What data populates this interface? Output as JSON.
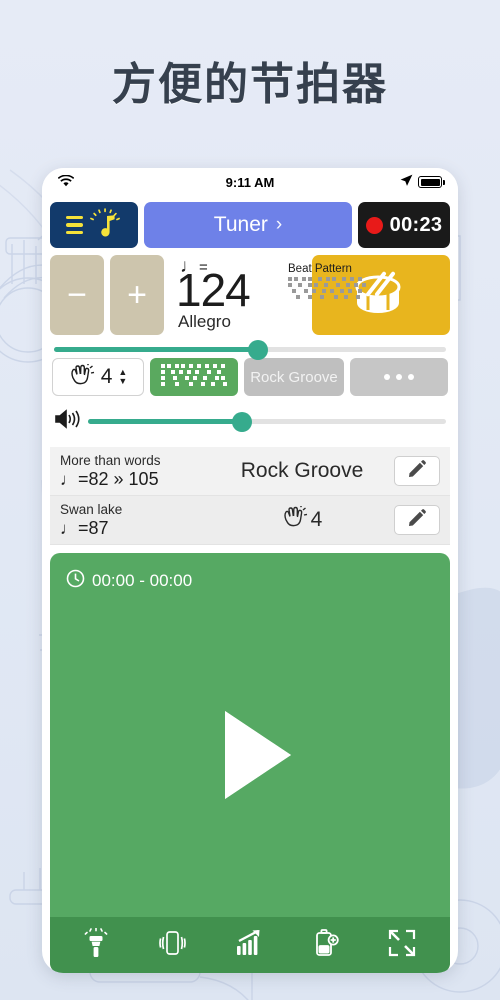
{
  "headline": "方便的节拍器",
  "statusbar": {
    "wifi_icon": "wifi-icon",
    "time": "9:11 AM",
    "location_icon": "location-arrow-icon",
    "battery_icon": "battery-full-icon"
  },
  "toolbar_top": {
    "menu_icon": "hamburger-icon",
    "metronome_icon": "metronome-note-icon",
    "tuner_label": "Tuner",
    "tuner_chevron": "›",
    "record_dot_icon": "record-dot-icon",
    "record_time": "00:23"
  },
  "tempo": {
    "minus_label": "−",
    "plus_label": "+",
    "note_glyph": "♩",
    "equals": "=",
    "bpm": "124",
    "tempo_name": "Allegro",
    "beat_pattern_label": "Beat Pattern",
    "drum_icon": "snare-drum-icon",
    "tempo_slider_percent": 52
  },
  "volume": {
    "speaker_icon": "speaker-waves-icon",
    "volume_slider_percent": 43
  },
  "beatrow": {
    "hands_icon": "clapping-hands-icon",
    "beats": "4",
    "stepper_up": "▲",
    "stepper_down": "▼",
    "pattern_icon": "beat-pattern-icon",
    "groove_label": "Rock Groove",
    "more_icon": "ellipsis-icon"
  },
  "songs": [
    {
      "title": "More than words",
      "note_glyph": "♩",
      "bpm": "=82 » 105",
      "middle": "Rock Groove",
      "middle_icon": "",
      "edit_icon": "pencil-icon"
    },
    {
      "title": "Swan lake",
      "note_glyph": "♩",
      "bpm": "=87",
      "middle": "4",
      "middle_icon": "clapping-hands-icon",
      "edit_icon": "pencil-icon"
    }
  ],
  "player": {
    "clock_icon": "clock-icon",
    "time_range": "00:00 - 00:00",
    "play_icon": "play-triangle-icon",
    "tools": [
      {
        "icon": "flashlight-icon",
        "label": "Flashlight"
      },
      {
        "icon": "vibrate-phone-icon",
        "label": "Vibrate"
      },
      {
        "icon": "bar-chart-up-icon",
        "label": "Tempo Ramp"
      },
      {
        "icon": "battery-plus-icon",
        "label": "Battery Saver"
      },
      {
        "icon": "fullscreen-expand-icon",
        "label": "Fullscreen"
      }
    ]
  },
  "colors": {
    "page_background": "#e3e9f4",
    "headline": "#36404e",
    "menu_navy": "#123a6b",
    "menu_yellow": "#f5e23a",
    "tuner_blue": "#6e81e8",
    "record_black": "#1a1a1a",
    "record_red": "#e81a19",
    "step_tan": "#cdc5ad",
    "drum_gold": "#e8b51e",
    "slider_teal": "#36ab8d",
    "pattern_green": "#5aa95f",
    "grey_button": "#bfbfbf",
    "player_green": "#56a963",
    "toolbar_green": "#41914e"
  }
}
